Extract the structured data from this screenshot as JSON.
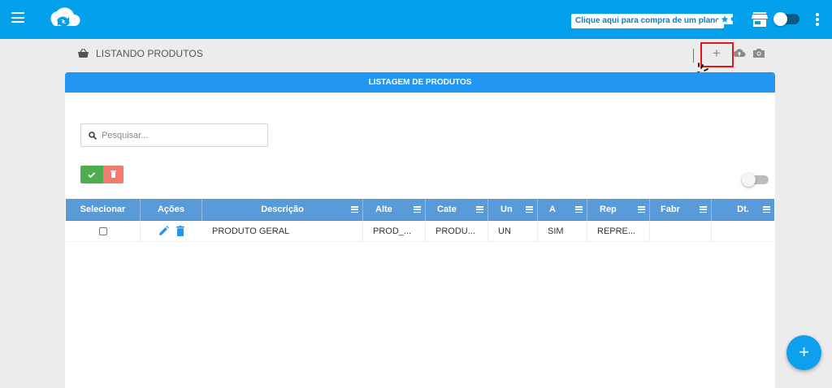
{
  "topbar": {
    "menu_icon": "hamburger-icon",
    "logo_icon": "cloud-arrows-logo",
    "plan_button": "Clique aqui para compra de um plano",
    "ticket_icon": "ticket-star-icon",
    "store_icon": "store-icon",
    "toggle_state": "on",
    "more_icon": "kebab-menu-icon"
  },
  "page": {
    "title": "LISTANDO PRODUTOS",
    "title_icon": "basket-icon",
    "actions": [
      "plus-icon",
      "cloud-upload-icon",
      "camera-icon"
    ],
    "plus_symbol": "+"
  },
  "card": {
    "header": "LISTAGEM DE PRODUTOS",
    "search": {
      "placeholder": "Pesquisar...",
      "value": ""
    },
    "toggle_state": "off"
  },
  "table": {
    "columns": [
      "Selecionar",
      "Ações",
      "Descrição",
      "Alte",
      "Cate",
      "Un",
      "A",
      "Rep",
      "Fabr",
      "Dt."
    ],
    "row": {
      "selected": false,
      "descricao": "PRODUTO GERAL",
      "alte": "PROD_...",
      "cate": "PRODU...",
      "un": "UN",
      "a": "SIM",
      "rep": "REPRE...",
      "fabr": "",
      "dt": ""
    }
  },
  "fab": {
    "symbol": "+"
  },
  "colors": {
    "topbar": "#03a0ec",
    "card_header": "#2196f3",
    "grid_header": "#599bd8",
    "confirm": "#4cae4f",
    "delete": "#f37a6f",
    "highlight": "#e3141b",
    "fab": "#0ea0ee"
  }
}
